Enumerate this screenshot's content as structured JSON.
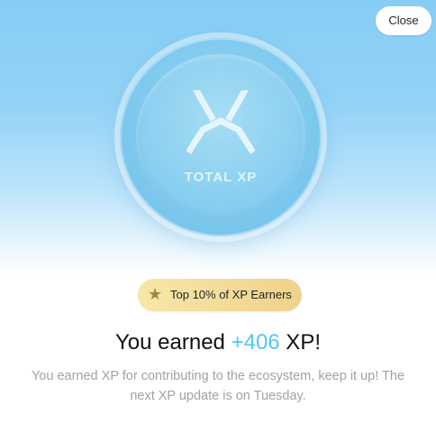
{
  "actions": {
    "close_label": "Close"
  },
  "coin": {
    "label": "TOTAL XP",
    "logo_icon": "tri-chevron-logo-icon"
  },
  "badge": {
    "icon": "star-icon",
    "text": "Top 10% of XP Earners"
  },
  "summary": {
    "prefix": "You earned ",
    "amount": "+406",
    "suffix": " XP!"
  },
  "message": {
    "line1": "You earned XP for contributing to the ecosystem, keep it up! The",
    "line2": "next XP update is on Tuesday."
  },
  "colors": {
    "hero_blue": "#86cdf5",
    "coin_blue": "#7fcaee",
    "badge_gold": "#efd28b",
    "amount_blue": "#53c6f4",
    "text_dark": "#111111",
    "text_muted": "#a2a2a2"
  }
}
